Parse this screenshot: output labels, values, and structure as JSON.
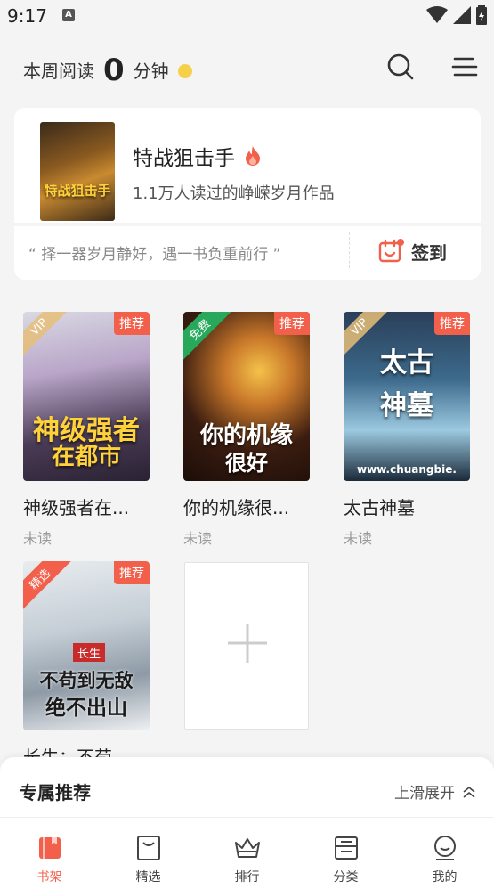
{
  "status_bar": {
    "time": "9:17",
    "notif_glyph": "A"
  },
  "header": {
    "reading_prefix": "本周阅读",
    "reading_minutes": "0",
    "reading_suffix": "分钟"
  },
  "featured": {
    "title": "特战狙击手",
    "subtitle": "1.1万人读过的峥嵘岁月作品",
    "cover_text": "特战狙击手",
    "quote": "“ 择一器岁月静好，遇一书负重前行 ”",
    "checkin_label": "签到"
  },
  "books": [
    {
      "title": "神级强者在...",
      "status": "未读",
      "tag": "推荐",
      "corner": "VIP",
      "cover_text_1": "神级强者",
      "cover_text_2": "在都市"
    },
    {
      "title": "你的机缘很...",
      "status": "未读",
      "tag": "推荐",
      "corner": "免费",
      "cover_text_1": "你的机缘",
      "cover_text_2": "很好"
    },
    {
      "title": "太古神墓",
      "status": "未读",
      "tag": "推荐",
      "corner": "VIP",
      "cover_text_1": "太古",
      "cover_text_2": "神墓",
      "cover_url": "www.chuangbie."
    },
    {
      "title": "长生：不苟...",
      "status": "",
      "tag": "推荐",
      "corner": "精选",
      "cover_text_1": "不苟到无敌",
      "cover_text_2": "绝不出山",
      "cover_badge": "长生"
    }
  ],
  "recommend": {
    "title": "专属推荐",
    "expand_label": "上滑展开"
  },
  "tabs": [
    {
      "label": "书架",
      "icon": "bookshelf-icon",
      "active": true
    },
    {
      "label": "精选",
      "icon": "featured-bag-icon",
      "active": false
    },
    {
      "label": "排行",
      "icon": "crown-icon",
      "active": false
    },
    {
      "label": "分类",
      "icon": "category-box-icon",
      "active": false
    },
    {
      "label": "我的",
      "icon": "profile-icon",
      "active": false
    }
  ],
  "colors": {
    "accent": "#f2604c",
    "coin": "#f7d04a",
    "background": "#f4f4f4"
  }
}
